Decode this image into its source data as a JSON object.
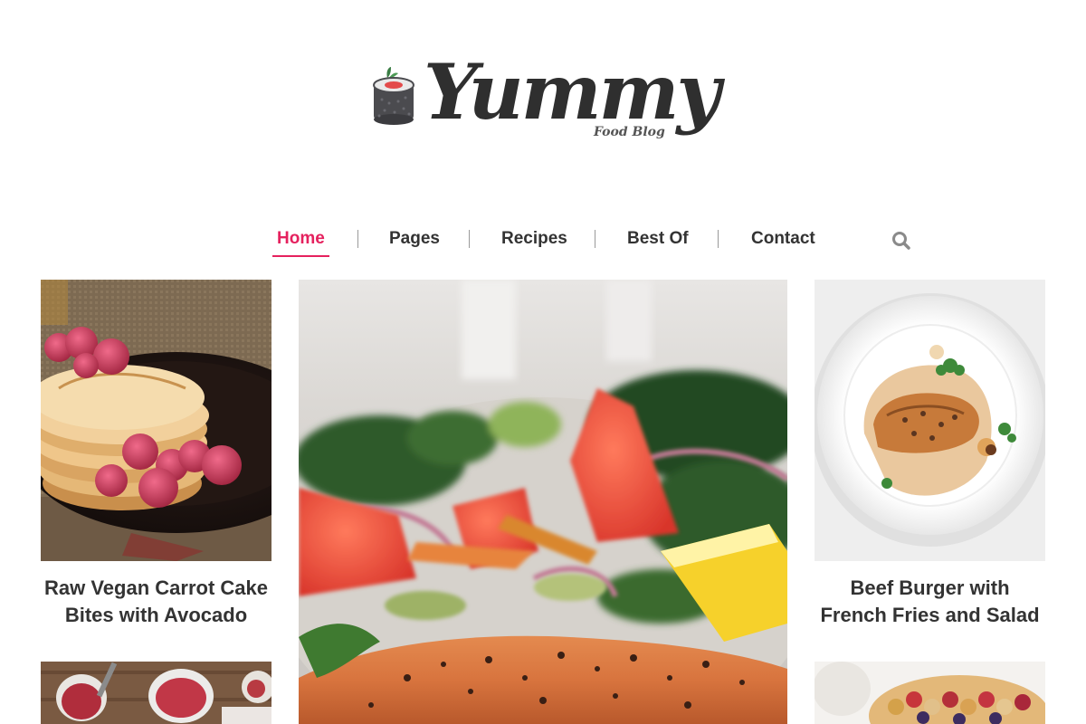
{
  "site": {
    "name": "Yummy",
    "tagline": "Food Blog",
    "logo_icon": "sushi-roll-icon"
  },
  "nav": {
    "items": [
      {
        "label": "Home",
        "active": true
      },
      {
        "label": "Pages",
        "active": false
      },
      {
        "label": "Recipes",
        "active": false
      },
      {
        "label": "Best Of",
        "active": false
      },
      {
        "label": "Contact",
        "active": false
      }
    ],
    "search_icon": "search-icon"
  },
  "colors": {
    "accent": "#e5215e",
    "text": "#333333",
    "background": "#ffffff"
  },
  "posts": {
    "left_top": {
      "title_line1": "Raw Vegan Carrot Cake",
      "title_line2": "Bites with Avocado",
      "image": "pancakes-with-raspberries"
    },
    "center": {
      "image": "salmon-with-salad"
    },
    "right_top": {
      "title_line1": "Beef Burger with",
      "title_line2": "French Fries and Salad",
      "image": "plated-chicken-dish"
    },
    "left_bottom": {
      "image": "jam-jars"
    },
    "right_bottom": {
      "image": "berry-tart"
    }
  }
}
